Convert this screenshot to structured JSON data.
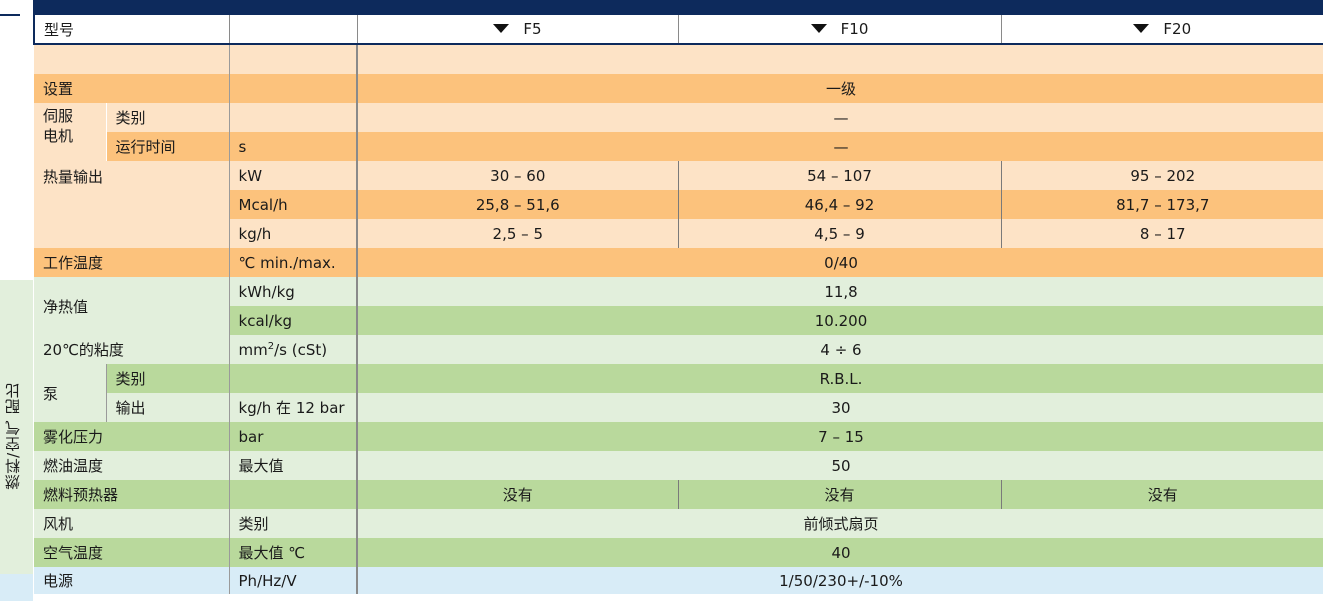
{
  "header": {
    "model_label": "型号",
    "models": [
      "F5",
      "F10",
      "F20"
    ]
  },
  "side_label": "燃料/空气 配比",
  "rows": {
    "settings": {
      "label": "设置",
      "value": "一级"
    },
    "servo": {
      "label": "伺服\n电机",
      "type_label": "类别",
      "type_value": "—",
      "runtime_label": "运行时间",
      "runtime_unit": "s",
      "runtime_value": "—"
    },
    "heat_output": {
      "label": "热量输出",
      "kw": {
        "unit": "kW",
        "values": [
          "30 – 60",
          "54 – 107",
          "95 – 202"
        ]
      },
      "mcal": {
        "unit": "Mcal/h",
        "values": [
          "25,8 – 51,6",
          "46,4 – 92",
          "81,7 – 173,7"
        ]
      },
      "kgh": {
        "unit": "kg/h",
        "values": [
          "2,5 – 5",
          "4,5 – 9",
          "8 – 17"
        ]
      }
    },
    "working_temp": {
      "label": "工作温度",
      "unit": "℃ min./max.",
      "value": "0/40"
    },
    "net_heat": {
      "label": "净热值",
      "kwh": {
        "unit": "kWh/kg",
        "value": "11,8"
      },
      "kcal": {
        "unit": "kcal/kg",
        "value": "10.200"
      }
    },
    "viscosity": {
      "label": "20℃的粘度",
      "unit_base": "mm",
      "unit_sup": "2",
      "unit_rest": "/s (cSt)",
      "value": "4 ÷ 6"
    },
    "pump": {
      "label": "泵",
      "type_label": "类别",
      "type_value": "R.B.L.",
      "output_label": "输出",
      "output_unit": "kg/h 在 12 bar",
      "output_value": "30"
    },
    "atomizing": {
      "label": "雾化压力",
      "unit": "bar",
      "value": "7 – 15"
    },
    "oil_temp": {
      "label": "燃油温度",
      "unit": "最大值",
      "value": "50"
    },
    "preheater": {
      "label": "燃料预热器",
      "values": [
        "没有",
        "没有",
        "没有"
      ]
    },
    "fan": {
      "label": "风机",
      "unit": "类别",
      "value": "前倾式扇页"
    },
    "air_temp": {
      "label": "空气温度",
      "unit": "最大值 ℃",
      "value": "40"
    },
    "power": {
      "label": "电源",
      "unit": "Ph/Hz/V",
      "value": "1/50/230+/-10%"
    }
  }
}
